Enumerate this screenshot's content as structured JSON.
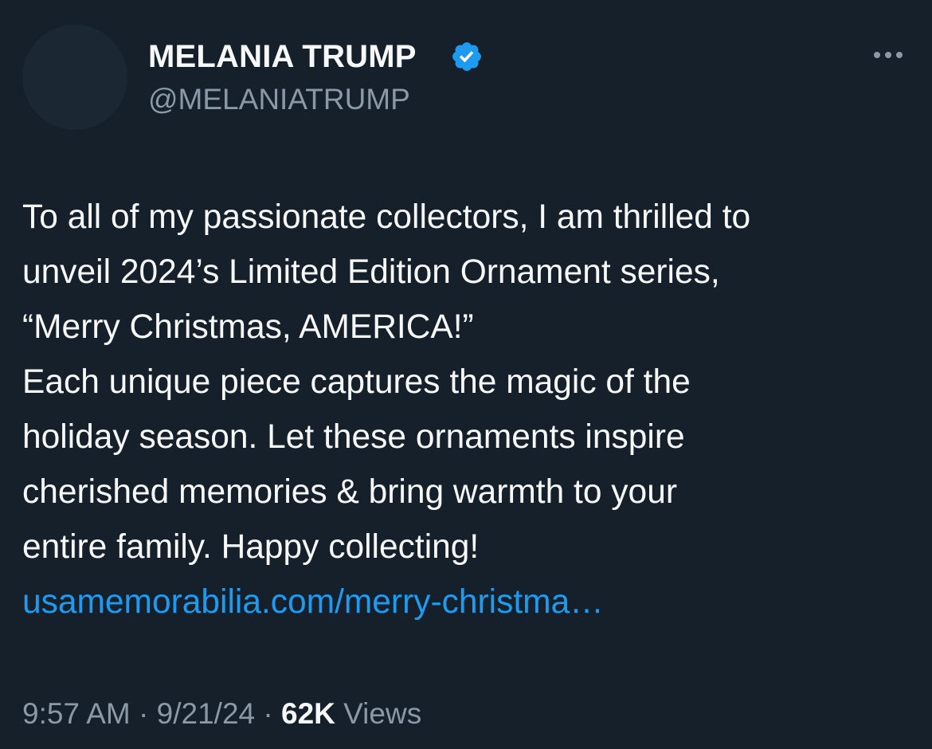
{
  "author": {
    "display_name": "MELANIA TRUMP",
    "handle": "@MELANIATRUMP",
    "verified": true,
    "verified_badge_color": "#1d9bf0"
  },
  "more_menu_icon": "more-horizontal-icon",
  "tweet": {
    "lines": [
      "To all of my passionate collectors, I am thrilled to",
      "unveil 2024’s Limited Edition Ornament series,",
      "“Merry Christmas, AMERICA!”",
      "Each unique piece captures the magic of the",
      "holiday season. Let these ornaments inspire",
      "cherished memories & bring warmth to your",
      "entire family. Happy collecting!"
    ],
    "link_text": "usamemorabilia.com/merry-christma…"
  },
  "meta": {
    "time": "9:57 AM",
    "date": "9/21/24",
    "separator": "·",
    "views_count": "62K",
    "views_label": "Views"
  },
  "colors": {
    "background": "#15202b",
    "text": "#f7f9f9",
    "secondary_text": "#8b98a5",
    "link": "#1d9bf0"
  }
}
